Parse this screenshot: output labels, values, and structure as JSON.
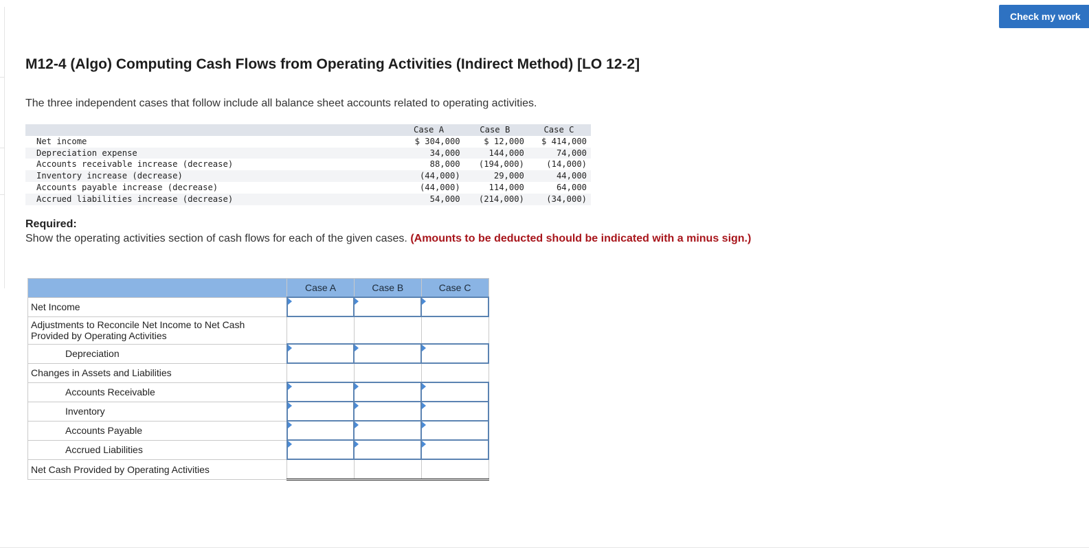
{
  "header": {
    "check_button": "Check my work"
  },
  "problem": {
    "title": "M12-4 (Algo) Computing Cash Flows from Operating Activities (Indirect Method) [LO 12-2]",
    "intro": "The three independent cases that follow include all balance sheet accounts related to operating activities."
  },
  "given_table": {
    "headers": [
      "Case A",
      "Case B",
      "Case C"
    ],
    "rows": [
      {
        "label": "Net income",
        "a": "$ 304,000",
        "b": "$ 12,000",
        "c": "$ 414,000"
      },
      {
        "label": "Depreciation expense",
        "a": "34,000",
        "b": "144,000",
        "c": "74,000"
      },
      {
        "label": "Accounts receivable increase (decrease)",
        "a": "88,000",
        "b": "(194,000)",
        "c": "(14,000)"
      },
      {
        "label": "Inventory increase (decrease)",
        "a": "(44,000)",
        "b": "29,000",
        "c": "44,000"
      },
      {
        "label": "Accounts payable increase (decrease)",
        "a": "(44,000)",
        "b": "114,000",
        "c": "64,000"
      },
      {
        "label": "Accrued liabilities increase (decrease)",
        "a": "54,000",
        "b": "(214,000)",
        "c": "(34,000)"
      }
    ]
  },
  "required": {
    "heading": "Required:",
    "text": "Show the operating activities section of cash flows for each of the given cases.",
    "note": "(Amounts to be deducted should be indicated with a minus sign.)"
  },
  "answer_table": {
    "headers": [
      "Case A",
      "Case B",
      "Case C"
    ],
    "rows": [
      {
        "label": "Net Income",
        "indent": false,
        "input": true,
        "height": "r26"
      },
      {
        "label": "Adjustments to Reconcile Net Income to Net Cash Provided by Operating Activities",
        "indent": false,
        "input": false,
        "height": "r38"
      },
      {
        "label": "Depreciation",
        "indent": true,
        "input": true,
        "height": "r26"
      },
      {
        "label": "Changes in Assets and Liabilities",
        "indent": false,
        "input": false,
        "height": "r26"
      },
      {
        "label": "Accounts Receivable",
        "indent": true,
        "input": true,
        "height": "r26"
      },
      {
        "label": "Inventory",
        "indent": true,
        "input": true,
        "height": "r26"
      },
      {
        "label": "Accounts Payable",
        "indent": true,
        "input": true,
        "height": "r26"
      },
      {
        "label": "Accrued Liabilities",
        "indent": true,
        "input": true,
        "height": "r26"
      },
      {
        "label": "Net Cash Provided by Operating Activities",
        "indent": false,
        "input": false,
        "total": true,
        "height": "r34"
      }
    ]
  }
}
